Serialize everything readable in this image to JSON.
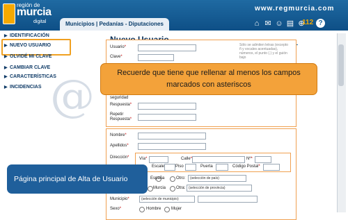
{
  "header": {
    "logo_line1": "región de",
    "logo_line2": "murcia",
    "logo_line3": "digital",
    "site_url": "www.regmurcia.com",
    "tabs_label": "Municipios | Pedanías - Diputaciones",
    "notification_count": "112",
    "help_label": "?"
  },
  "menu": {
    "items": [
      {
        "label": "IDENTIFICACIÓN"
      },
      {
        "label": "NUEVO USUARIO"
      },
      {
        "label": "OLVIDÉ MI CLAVE"
      },
      {
        "label": "CAMBIAR CLAVE"
      },
      {
        "label": "CARACTERÍSTICAS"
      },
      {
        "label": "INCIDENCIAS"
      }
    ],
    "selected_index": 1
  },
  "main": {
    "title": "Nuevo Usuario",
    "account": {
      "usuario_label": "Usuario",
      "clave_label": "Clave",
      "hint": "Sólo se admiten letras (excepto ñ y vocales acentuadas), números, el punto (.) y el guión bajo",
      "seguridad_label": "seguridad",
      "respuesta_label": "Respuesta",
      "repetir_label": "Repetir",
      "respuesta2_label": "Respuesta"
    },
    "personal": {
      "nombre_label": "Nombre",
      "apellidos_label": "Apellidos",
      "direccion_label": "Dirección",
      "via_label": "Vía",
      "calle_label": "Calle",
      "numero_label": "Nº",
      "escalera_label": "Escalera",
      "piso_label": "Piso",
      "puerta_label": "Puerta",
      "codigo_postal_label": "Código Postal",
      "pais_spain": "España",
      "pais_otro": "Otro:",
      "pais_select": "(selección de país)",
      "provincia_murcia": "Murcia",
      "provincia_otra": "Otra:",
      "provincia_select": "(selección de provincia)",
      "municipio_label": "Municipio",
      "municipio_select": "(selección de municipio)",
      "sexo_label": "Sexo",
      "hombre_label": "Hombre",
      "mujer_label": "Mujer",
      "required_mark": "*"
    }
  },
  "overlays": {
    "tooltip_text": "Recuerde que tiene que rellenar al menos los campos marcados con asteriscos",
    "caption_text": "Página principal de Alta de Usuario"
  },
  "colors": {
    "header_blue": "#0e4f86",
    "accent_orange": "#f3a23a",
    "caption_blue": "#1f5f9b"
  }
}
